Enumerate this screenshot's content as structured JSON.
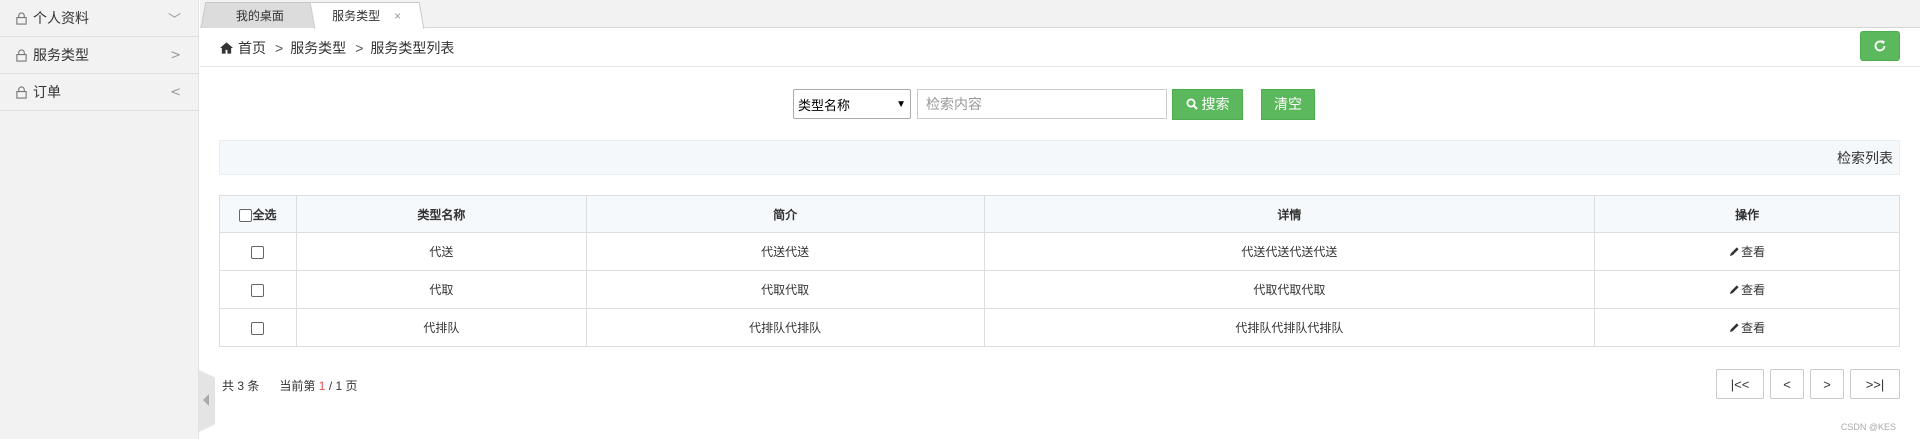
{
  "sidebar": {
    "items": [
      {
        "label": "个人资料",
        "chevron": "﹀"
      },
      {
        "label": "服务类型",
        "chevron": ">"
      },
      {
        "label": "订单",
        "chevron": "<"
      }
    ]
  },
  "tabs": [
    {
      "label": "我的桌面"
    },
    {
      "label": "服务类型",
      "close": "×"
    }
  ],
  "breadcrumb": {
    "home": "首页",
    "sep": ">",
    "level1": "服务类型",
    "level2": "服务类型列表"
  },
  "search": {
    "select_value": "类型名称",
    "placeholder": "检索内容",
    "search_label": "搜索",
    "clear_label": "清空"
  },
  "panel": {
    "title": "检索列表"
  },
  "table": {
    "headers": {
      "select_all": "全选",
      "name": "类型名称",
      "intro": "简介",
      "detail": "详情",
      "action": "操作"
    },
    "rows": [
      {
        "name": "代送",
        "intro": "代送代送",
        "detail": "代送代送代送代送",
        "action": "查看"
      },
      {
        "name": "代取",
        "intro": "代取代取",
        "detail": "代取代取代取",
        "action": "查看"
      },
      {
        "name": "代排队",
        "intro": "代排队代排队",
        "detail": "代排队代排队代排队",
        "action": "查看"
      }
    ]
  },
  "pagination": {
    "total_prefix": "共",
    "total": "3",
    "total_suffix": "条",
    "current_prefix": "当前第",
    "current": "1",
    "slash": "/",
    "pages": "1",
    "pages_suffix": "页",
    "first": "|<<",
    "prev": "<",
    "next": ">",
    "last": ">>|"
  },
  "watermark": "CSDN @KES",
  "colors": {
    "accent": "#5cb85c",
    "current_page": "#d9534f"
  }
}
